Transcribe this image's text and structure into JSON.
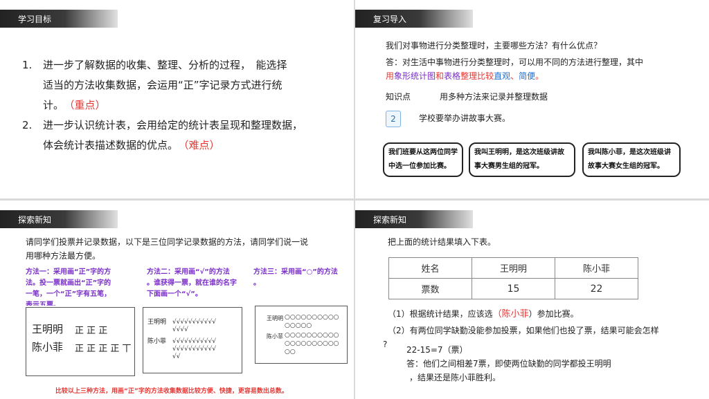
{
  "slide1": {
    "header": "学习目标",
    "item1_num": "1.",
    "item1_line1": "进一步了解数据的收集、整理、分析的过程，　能选择",
    "item1_line2": "适当的方法收集数据，会运用“正”字记录方式进行统",
    "item1_line3": "计。",
    "item1_tag": "（重点）",
    "item2_num": "2.",
    "item2_line1": "进一步认识统计表，会用给定的统计表呈现和整理数据，",
    "item2_line2": "体会统计表描述数据的优点。",
    "item2_tag": "（难点）"
  },
  "slide2": {
    "header": "复习导入",
    "question": "我们对事物进行分类整理时，主要哪些方法？有什么优点？",
    "answer_line1": "答：对生活中事物进行分类整理时，可以用不同的方法进行整理，其中",
    "answer_a": "用",
    "answer_b": "象形统计图",
    "answer_c": "和",
    "answer_d": "表格",
    "answer_e": "整理比较",
    "answer_f": "直观",
    "answer_g": "、",
    "answer_h": "简便",
    "answer_i": "。",
    "knowledge_label": "知识点",
    "knowledge_text": "用多种方法来记录并整理数据",
    "problem_num": "2",
    "problem_text": "学校要举办讲故事大赛。",
    "bubble1": "我们班要从这两位同学中选一位参加比赛。",
    "bubble2": "我叫王明明，是这次班级讲故事大赛男生组的冠军。",
    "bubble3": "我叫陈小菲，是这次班级讲故事大赛女生组的冠军。"
  },
  "slide3": {
    "header": "探索新知",
    "intro_line1": "请同学们投票并记录数据，以下是三位同学记录数据的方法，请同学们说一说",
    "intro_line2": "用哪种方法最方便。",
    "method1_line1": "方法一：采用画“正”字的方",
    "method1_line2": "法。投一票就画出“正”字的",
    "method1_line3": "一笔，一个“正”字有五笔，",
    "method1_line4": "表示五票。",
    "method2_line1": "方法二：采用画“√”的方法",
    "method2_line2": "。谁获得一票，就在谁的名字",
    "method2_line3": "下面画一个“√”。",
    "method3_line1": "方法三：采用画“○”的方法",
    "method3_line2": "。",
    "box1_name1": "王明明",
    "box1_marks1": "正 正 正",
    "box1_name2": "陈小菲",
    "box1_marks2": "正 正 正 正 丅",
    "box2_name1": "王明明",
    "box2_marks1a": "√√√√√√√√√√√",
    "box2_marks1b": "√√√√",
    "box2_name2": "陈小菲",
    "box2_marks2a": "√√√√√√√√√√√",
    "box2_marks2b": "√√√√√√√√√√√",
    "box2_marks2c": "√√",
    "box3_name1": "王明明",
    "box3_marks1a": "○○○○○○○○○○",
    "box3_marks1b": "○○○○○",
    "box3_name2": "陈小菲",
    "box3_marks2a": "○○○○○○○○○○",
    "box3_marks2b": "○○○○○○○○○○",
    "box3_marks2c": "○○",
    "conclusion": "比较以上三种方法，用画“正”字的方法收集数据比较方便、快捷，更容易数出总数。"
  },
  "slide4": {
    "header": "探索新知",
    "instruction": "把上面的统计结果填入下表。",
    "table": {
      "h0": "姓名",
      "h1": "王明明",
      "h2": "陈小菲",
      "r0": "票数",
      "r1": "15",
      "r2": "22"
    },
    "q1_pre": "（1）根据统计结果，应该选",
    "q1_answer": "（陈小菲",
    "q1_post": "）参加比赛。",
    "q2_line1": "（2）有两位同学缺勤没能参加投票，如果他们也投了票，结果可能会怎样",
    "q2_mark": "?",
    "calc": "22-15=7（票）",
    "ans_line1": "答：他们之间相差7票，即使两位缺勤的同学都投王明明",
    "ans_line2": "，结果还是陈小菲胜利。"
  },
  "colors": {
    "accent_red": "#e53935",
    "accent_blue": "#1f6fd1",
    "accent_purple": "#7b2fc9"
  }
}
